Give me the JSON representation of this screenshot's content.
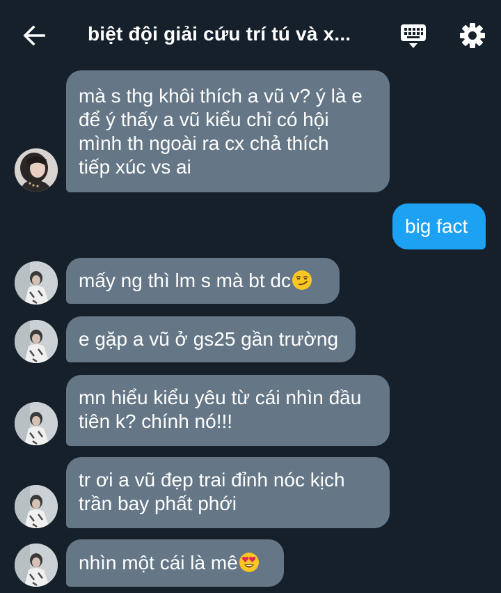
{
  "header": {
    "title": "biệt đội giải cứu trí tú và x...",
    "back_icon": "arrow-left-icon",
    "keyboard_icon": "keyboard-icon",
    "settings_icon": "gear-icon"
  },
  "colors": {
    "background": "#15202b",
    "incoming_bubble": "#657786",
    "outgoing_bubble": "#1da1f2"
  },
  "messages": [
    {
      "direction": "incoming",
      "lines": [
        "mà s thg khôi thích a vũ v? ý là e",
        "để ý thấy a vũ kiểu chỉ có hội",
        "mình th ngoài ra cx chả thích",
        "tiếp xúc vs ai"
      ]
    },
    {
      "direction": "outgoing",
      "lines": [
        "big fact"
      ]
    },
    {
      "direction": "incoming",
      "lines": [
        "mấy ng thì lm s mà bt dc"
      ],
      "emoji": "smirk-emoji"
    },
    {
      "direction": "incoming",
      "lines": [
        "e gặp a vũ ở gs25 gần trường"
      ]
    },
    {
      "direction": "incoming",
      "lines": [
        "mn hiểu kiểu yêu từ cái nhìn đầu",
        "tiên k? chính nó!!!"
      ]
    },
    {
      "direction": "incoming",
      "lines": [
        "tr ơi a vũ đẹp trai đỉnh nóc kịch",
        "trần bay phất phới"
      ]
    },
    {
      "direction": "incoming",
      "lines": [
        "nhìn một cái là mê"
      ],
      "emoji": "heart-eyes-emoji"
    }
  ]
}
